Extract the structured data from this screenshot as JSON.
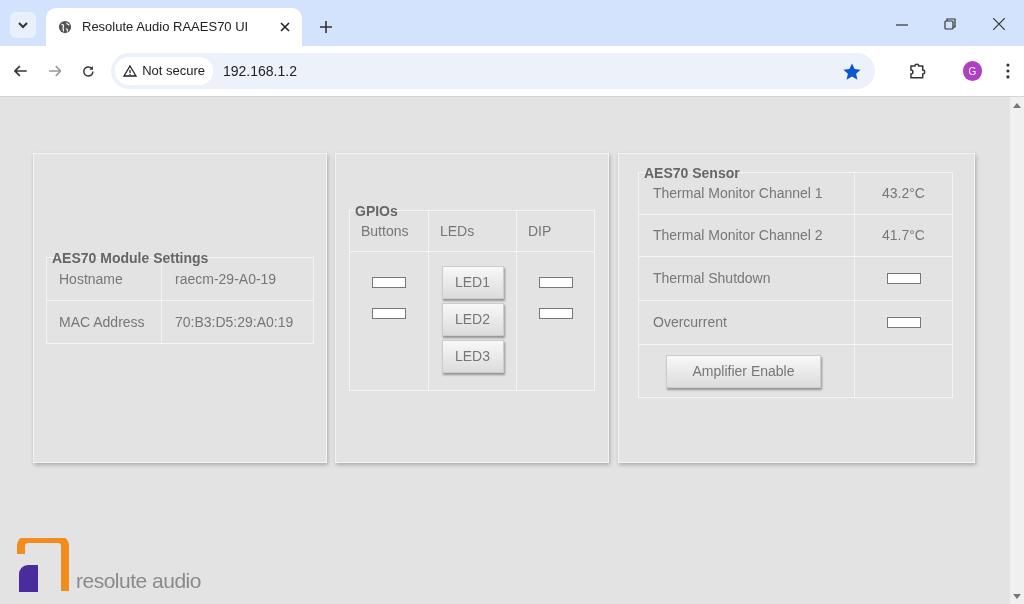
{
  "browser": {
    "tab_title": "Resolute Audio RAAES70 UI",
    "security_label": "Not secure",
    "url": "192.168.1.2",
    "profile_initial": "G",
    "bookmarked": true
  },
  "panels": [
    {
      "kind": "info",
      "title": "AES70 Module Settings",
      "rows": [
        {
          "label": "Hostname",
          "value": "raecm-29-A0-19"
        },
        {
          "label": "MAC Address",
          "value": "70:B3:D5:29:A0:19"
        }
      ]
    },
    {
      "kind": "gpio",
      "title": "GPIOs",
      "columns": [
        "Buttons",
        "LEDs",
        "DIP"
      ],
      "buttons": [
        {
          "on": false
        },
        {
          "on": false
        }
      ],
      "leds": [
        "LED1",
        "LED2",
        "LED3"
      ],
      "dip": [
        {
          "on": false
        },
        {
          "on": false
        }
      ]
    },
    {
      "kind": "sensor",
      "title": "AES70 Sensor",
      "rows": [
        {
          "kind": "reading",
          "label": "Thermal Monitor Channel 1",
          "value": "43.2°C"
        },
        {
          "kind": "reading",
          "label": "Thermal Monitor Channel 2",
          "value": "41.7°C"
        },
        {
          "kind": "indicator",
          "label": "Thermal Shutdown",
          "on": false
        },
        {
          "kind": "indicator",
          "label": "Overcurrent",
          "on": false
        },
        {
          "kind": "button",
          "label": "Amplifier Enable"
        }
      ]
    }
  ],
  "logo": {
    "text": "resolute audio"
  }
}
